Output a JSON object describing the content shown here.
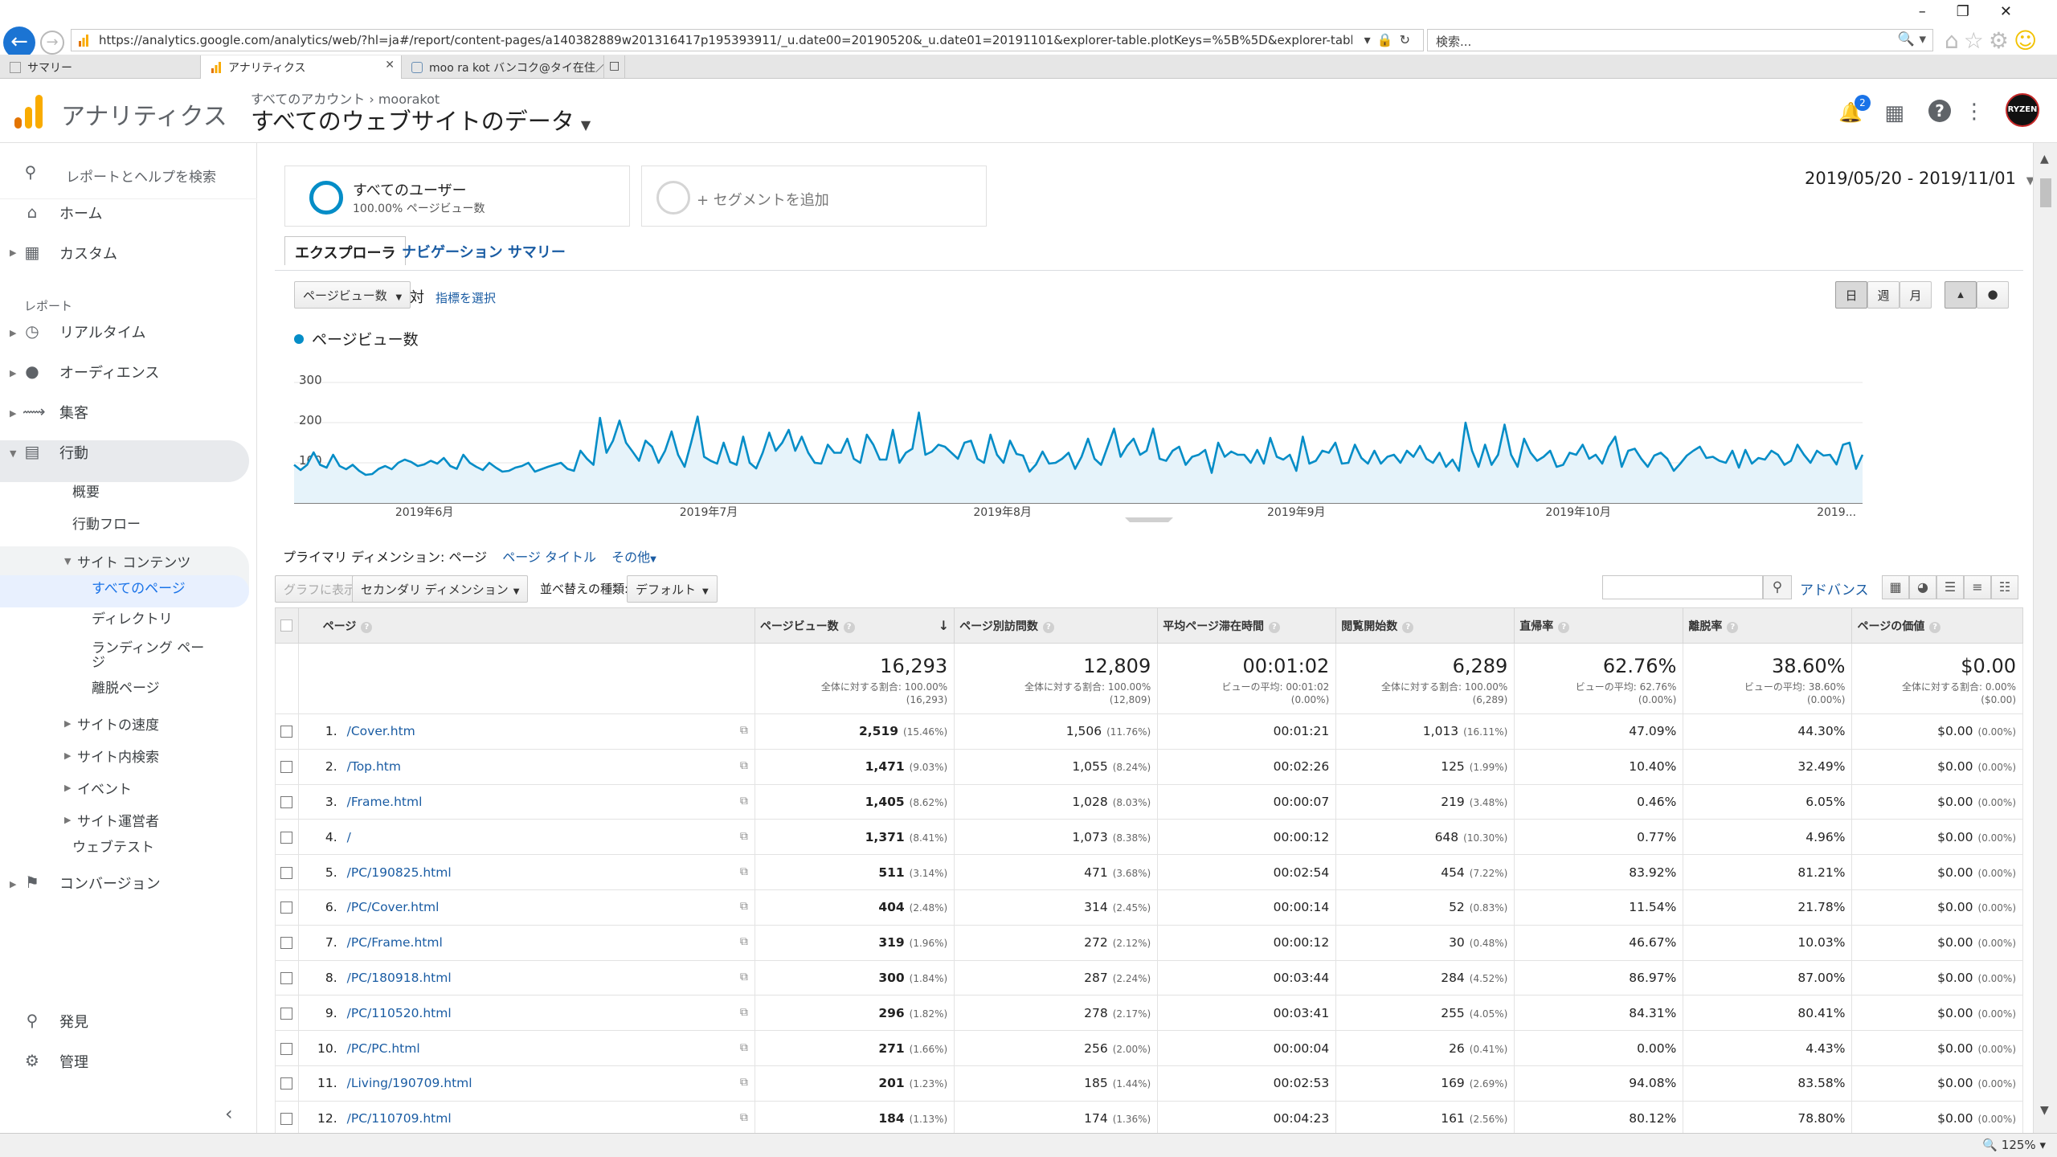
{
  "browser": {
    "url": "https://analytics.google.com/analytics/web/?hl=ja#/report/content-pages/a140382889w201316417p195393911/_u.date00=20190520&_u.date01=20191101&explorer-table.plotKeys=%5B%5D&explorer-table.rowStart=0&explorer-table.r",
    "search_placeholder": "検索...",
    "tabs": [
      {
        "label": "サマリー",
        "active": false
      },
      {
        "label": "アナリティクス",
        "active": true
      },
      {
        "label": "moo ra kot バンコク@タイ在住／...",
        "active": false
      }
    ],
    "zoom": "125%"
  },
  "header": {
    "app_name": "アナリティクス",
    "breadcrumb_account": "すべてのアカウント",
    "breadcrumb_sep": "›",
    "breadcrumb_property": "moorakot",
    "view_title": "すべてのウェブサイトのデータ",
    "notification_count": "2",
    "avatar_text": "RYZEN"
  },
  "sidebar": {
    "search_placeholder": "レポートとヘルプを検索",
    "home": "ホーム",
    "custom": "カスタム",
    "reports_section": "レポート",
    "realtime": "リアルタイム",
    "audience": "オーディエンス",
    "acquisition": "集客",
    "behavior": "行動",
    "overview": "概要",
    "behavior_flow": "行動フロー",
    "site_content": "サイト コンテンツ",
    "all_pages": "すべてのページ",
    "directory": "ディレクトリ",
    "landing_pages": "ランディング ページ",
    "exit_pages": "離脱ページ",
    "site_speed": "サイトの速度",
    "site_search": "サイト内検索",
    "events": "イベント",
    "publisher": "サイト運営者",
    "experiments": "ウェブテスト",
    "conversions": "コンバージョン",
    "discover": "発見",
    "admin": "管理"
  },
  "segments": {
    "all_users_title": "すべてのユーザー",
    "all_users_sub": "100.00% ページビュー数",
    "add_segment": "+ セグメントを追加"
  },
  "date_range": "2019/05/20 - 2019/11/01",
  "view_tabs": {
    "explorer": "エクスプローラ",
    "nav_summary": "ナビゲーション サマリー"
  },
  "chart_controls": {
    "metric": "ページビュー数",
    "vs": "対",
    "select_metric": "指標を選択",
    "day": "日",
    "week": "週",
    "month": "月"
  },
  "chart_data": {
    "type": "area",
    "series": [
      {
        "name": "ページビュー数"
      }
    ],
    "y_ticks": [
      "300",
      "200",
      "100"
    ],
    "ylim": [
      0,
      300
    ],
    "x_labels": [
      "2019年6月",
      "2019年7月",
      "2019年8月",
      "2019年9月",
      "2019年10月",
      "2019..."
    ],
    "values": [
      95,
      82,
      95,
      126,
      95,
      88,
      120,
      92,
      84,
      95,
      80,
      70,
      72,
      85,
      92,
      84,
      100,
      108,
      102,
      92,
      96,
      105,
      98,
      112,
      92,
      85,
      120,
      100,
      90,
      82,
      100,
      88,
      78,
      80,
      88,
      92,
      100,
      78,
      84,
      90,
      95,
      100,
      85,
      80,
      130,
      110,
      95,
      212,
      125,
      155,
      205,
      150,
      128,
      105,
      155,
      140,
      100,
      130,
      178,
      120,
      90,
      150,
      215,
      115,
      105,
      98,
      150,
      102,
      95,
      165,
      100,
      86,
      125,
      175,
      130,
      150,
      182,
      130,
      165,
      125,
      100,
      98,
      145,
      125,
      125,
      160,
      110,
      100,
      170,
      145,
      108,
      108,
      182,
      100,
      125,
      135,
      225,
      120,
      128,
      145,
      140,
      125,
      110,
      150,
      155,
      110,
      100,
      170,
      120,
      100,
      155,
      122,
      118,
      78,
      96,
      128,
      98,
      100,
      110,
      125,
      85,
      115,
      160,
      110,
      95,
      140,
      185,
      115,
      142,
      160,
      120,
      130,
      185,
      110,
      105,
      130,
      140,
      95,
      115,
      120,
      132,
      75,
      150,
      115,
      128,
      120,
      120,
      100,
      132,
      98,
      162,
      115,
      108,
      120,
      80,
      165,
      98,
      105,
      130,
      125,
      150,
      98,
      100,
      145,
      112,
      98,
      130,
      98,
      115,
      120,
      100,
      130,
      115,
      142,
      110,
      100,
      125,
      90,
      108,
      80,
      200,
      130,
      90,
      145,
      95,
      120,
      195,
      120,
      90,
      160,
      125,
      105,
      115,
      130,
      90,
      95,
      125,
      120,
      145,
      110,
      120,
      98,
      140,
      165,
      90,
      130,
      135,
      110,
      90,
      118,
      125,
      110,
      80,
      98,
      118,
      130,
      140,
      112,
      115,
      105,
      100,
      130,
      88,
      132,
      98,
      112,
      108,
      130,
      120,
      95,
      105,
      145,
      120,
      100,
      130,
      118,
      120,
      96,
      145,
      150,
      85,
      120
    ]
  },
  "dimensions": {
    "primary_label": "プライマリ ディメンション:",
    "page": "ページ",
    "page_title": "ページ タイトル",
    "other": "その他"
  },
  "table_tools": {
    "plot_rows": "グラフに表示",
    "secondary_dim": "セカンダリ ディメンション",
    "sort_label": "並べ替えの種類:",
    "sort_value": "デフォルト",
    "advanced": "アドバンス"
  },
  "table": {
    "columns": [
      "ページ",
      "ページビュー数",
      "ページ別訪問数",
      "平均ページ滞在時間",
      "閲覧開始数",
      "直帰率",
      "離脱率",
      "ページの価値"
    ],
    "totals": [
      {
        "big": "16,293",
        "sub1": "全体に対する割合: 100.00%",
        "sub2": "(16,293)"
      },
      {
        "big": "12,809",
        "sub1": "全体に対する割合: 100.00%",
        "sub2": "(12,809)"
      },
      {
        "big": "00:01:02",
        "sub1": "ビューの平均: 00:01:02",
        "sub2": "(0.00%)"
      },
      {
        "big": "6,289",
        "sub1": "全体に対する割合: 100.00%",
        "sub2": "(6,289)"
      },
      {
        "big": "62.76%",
        "sub1": "ビューの平均: 62.76%",
        "sub2": "(0.00%)"
      },
      {
        "big": "38.60%",
        "sub1": "ビューの平均: 38.60%",
        "sub2": "(0.00%)"
      },
      {
        "big": "$0.00",
        "sub1": "全体に対する割合: 0.00%",
        "sub2": "($0.00)"
      }
    ],
    "rows": [
      {
        "n": "1.",
        "page": "/Cover.htm",
        "pv": "2,519",
        "pv_pct": "(15.46%)",
        "uv": "1,506",
        "uv_pct": "(11.76%)",
        "time": "00:01:21",
        "ent": "1,013",
        "ent_pct": "(16.11%)",
        "bounce": "47.09%",
        "exit": "44.30%",
        "val": "$0.00",
        "val_pct": "(0.00%)"
      },
      {
        "n": "2.",
        "page": "/Top.htm",
        "pv": "1,471",
        "pv_pct": "(9.03%)",
        "uv": "1,055",
        "uv_pct": "(8.24%)",
        "time": "00:02:26",
        "ent": "125",
        "ent_pct": "(1.99%)",
        "bounce": "10.40%",
        "exit": "32.49%",
        "val": "$0.00",
        "val_pct": "(0.00%)"
      },
      {
        "n": "3.",
        "page": "/Frame.html",
        "pv": "1,405",
        "pv_pct": "(8.62%)",
        "uv": "1,028",
        "uv_pct": "(8.03%)",
        "time": "00:00:07",
        "ent": "219",
        "ent_pct": "(3.48%)",
        "bounce": "0.46%",
        "exit": "6.05%",
        "val": "$0.00",
        "val_pct": "(0.00%)"
      },
      {
        "n": "4.",
        "page": "/",
        "pv": "1,371",
        "pv_pct": "(8.41%)",
        "uv": "1,073",
        "uv_pct": "(8.38%)",
        "time": "00:00:12",
        "ent": "648",
        "ent_pct": "(10.30%)",
        "bounce": "0.77%",
        "exit": "4.96%",
        "val": "$0.00",
        "val_pct": "(0.00%)"
      },
      {
        "n": "5.",
        "page": "/PC/190825.html",
        "pv": "511",
        "pv_pct": "(3.14%)",
        "uv": "471",
        "uv_pct": "(3.68%)",
        "time": "00:02:54",
        "ent": "454",
        "ent_pct": "(7.22%)",
        "bounce": "83.92%",
        "exit": "81.21%",
        "val": "$0.00",
        "val_pct": "(0.00%)"
      },
      {
        "n": "6.",
        "page": "/PC/Cover.html",
        "pv": "404",
        "pv_pct": "(2.48%)",
        "uv": "314",
        "uv_pct": "(2.45%)",
        "time": "00:00:14",
        "ent": "52",
        "ent_pct": "(0.83%)",
        "bounce": "11.54%",
        "exit": "21.78%",
        "val": "$0.00",
        "val_pct": "(0.00%)"
      },
      {
        "n": "7.",
        "page": "/PC/Frame.html",
        "pv": "319",
        "pv_pct": "(1.96%)",
        "uv": "272",
        "uv_pct": "(2.12%)",
        "time": "00:00:12",
        "ent": "30",
        "ent_pct": "(0.48%)",
        "bounce": "46.67%",
        "exit": "10.03%",
        "val": "$0.00",
        "val_pct": "(0.00%)"
      },
      {
        "n": "8.",
        "page": "/PC/180918.html",
        "pv": "300",
        "pv_pct": "(1.84%)",
        "uv": "287",
        "uv_pct": "(2.24%)",
        "time": "00:03:44",
        "ent": "284",
        "ent_pct": "(4.52%)",
        "bounce": "86.97%",
        "exit": "87.00%",
        "val": "$0.00",
        "val_pct": "(0.00%)"
      },
      {
        "n": "9.",
        "page": "/PC/110520.html",
        "pv": "296",
        "pv_pct": "(1.82%)",
        "uv": "278",
        "uv_pct": "(2.17%)",
        "time": "00:03:41",
        "ent": "255",
        "ent_pct": "(4.05%)",
        "bounce": "84.31%",
        "exit": "80.41%",
        "val": "$0.00",
        "val_pct": "(0.00%)"
      },
      {
        "n": "10.",
        "page": "/PC/PC.html",
        "pv": "271",
        "pv_pct": "(1.66%)",
        "uv": "256",
        "uv_pct": "(2.00%)",
        "time": "00:00:04",
        "ent": "26",
        "ent_pct": "(0.41%)",
        "bounce": "0.00%",
        "exit": "4.43%",
        "val": "$0.00",
        "val_pct": "(0.00%)"
      },
      {
        "n": "11.",
        "page": "/Living/190709.html",
        "pv": "201",
        "pv_pct": "(1.23%)",
        "uv": "185",
        "uv_pct": "(1.44%)",
        "time": "00:02:53",
        "ent": "169",
        "ent_pct": "(2.69%)",
        "bounce": "94.08%",
        "exit": "83.58%",
        "val": "$0.00",
        "val_pct": "(0.00%)"
      },
      {
        "n": "12.",
        "page": "/PC/110709.html",
        "pv": "184",
        "pv_pct": "(1.13%)",
        "uv": "174",
        "uv_pct": "(1.36%)",
        "time": "00:04:23",
        "ent": "161",
        "ent_pct": "(2.56%)",
        "bounce": "80.12%",
        "exit": "78.80%",
        "val": "$0.00",
        "val_pct": "(0.00%)"
      }
    ]
  }
}
